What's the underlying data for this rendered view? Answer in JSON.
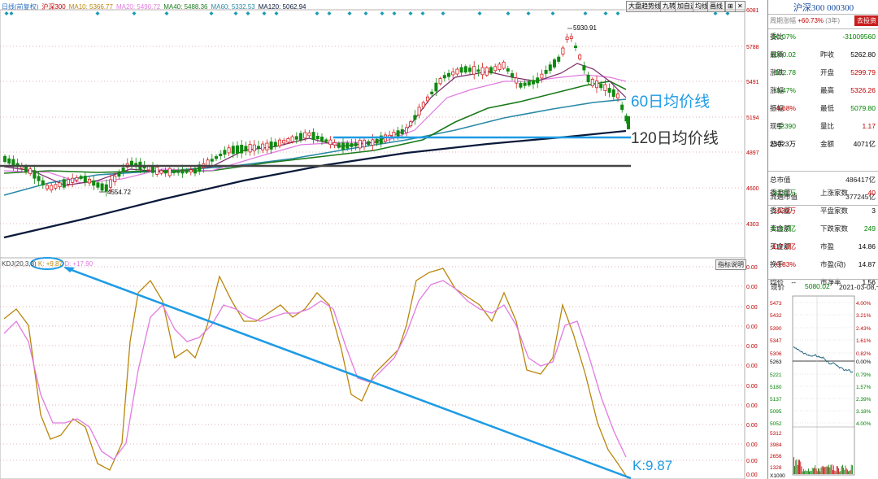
{
  "kline": {
    "period_label": "日线(前复权)",
    "index_name": "沪深300",
    "ma_legend": [
      {
        "label": "MA10: 5366.77",
        "color": "#b8860b"
      },
      {
        "label": "MA20: 5490.72",
        "color": "#e07be0"
      },
      {
        "label": "MA40: 5488.36",
        "color": "#1a7a1a"
      },
      {
        "label": "MA60: 5332.53",
        "color": "#2a8aa6"
      },
      {
        "label": "MA120: 5062.94",
        "color": "#0a1a3a"
      }
    ],
    "price_axis": [
      "6081",
      "5788",
      "5491",
      "5194",
      "4897",
      "4600",
      "4303"
    ],
    "high_label": "5930.91",
    "low_label": "4554.72",
    "annotation_60": "60日均价线",
    "annotation_120": "120日均价线"
  },
  "toolbar": {
    "buttons": [
      "大盘趋势线",
      "九转",
      "加自选",
      "均线",
      "画线"
    ],
    "expand_icon": "expand-icon",
    "close_icon": "close-icon"
  },
  "kdj": {
    "title": "KDJ(20,3,3)",
    "k_value": "K: +9.87",
    "d_value": "D: +17.90",
    "indicator_button": "指标说明",
    "axis_labels": [
      "0.00",
      "0.00",
      "0.00",
      "0.00",
      "0.00",
      "0.00",
      "0.00",
      "0.00",
      "0.00",
      "0.00",
      "0.00",
      "0.00"
    ],
    "annotation_k": "K:9.87"
  },
  "quote": {
    "title": "沪深300 000300",
    "period_stat_label": "周期涨幅",
    "period_stat_value": "+60.73%",
    "period_stat_suffix": "(3年)",
    "trade_button": "去投资",
    "rows": [
      [
        {
          "label": "委比",
          "value": "-60.07%",
          "color": "green"
        },
        {
          "label": "",
          "value": "-31009560",
          "color": "green"
        }
      ],
      [
        {
          "label": "最新",
          "value": "5080.02",
          "color": "green"
        },
        {
          "label": "昨收",
          "value": "5262.80",
          "color": "black"
        }
      ],
      [
        {
          "label": "涨跌",
          "value": "-182.78",
          "color": "green"
        },
        {
          "label": "开盘",
          "value": "5299.79",
          "color": "red"
        }
      ],
      [
        {
          "label": "涨幅",
          "value": "-3.47%",
          "color": "green"
        },
        {
          "label": "最高",
          "value": "5326.26",
          "color": "red"
        }
      ],
      [
        {
          "label": "振幅",
          "value": "4.68%",
          "color": "red"
        },
        {
          "label": "最低",
          "value": "5079.80",
          "color": "green"
        }
      ],
      [
        {
          "label": "现手",
          "value": "52390",
          "color": "green"
        },
        {
          "label": "量比",
          "value": "1.17",
          "color": "red"
        }
      ],
      [
        {
          "label": "总手",
          "value": "23023万",
          "color": "black"
        },
        {
          "label": "金额",
          "value": "4071亿",
          "color": "black"
        }
      ]
    ],
    "market_cap": [
      {
        "label": "总市值",
        "value": "486417亿"
      },
      {
        "label": "流通市值",
        "value": "377245亿"
      }
    ],
    "rows2": [
      [
        {
          "label": "委卖量",
          "value": "4131万",
          "color": "green"
        },
        {
          "label": "上涨家数",
          "value": "40",
          "color": "red"
        }
      ],
      [
        {
          "label": "委买量",
          "value": "1030万",
          "color": "red"
        },
        {
          "label": "平盘家数",
          "value": "3",
          "color": "black"
        }
      ],
      [
        {
          "label": "卖金额",
          "value": "513.7亿",
          "color": "green"
        },
        {
          "label": "下跌家数",
          "value": "249",
          "color": "green"
        }
      ],
      [
        {
          "label": "买金额",
          "value": "117.0亿",
          "color": "red"
        },
        {
          "label": "市盈",
          "value": "14.86",
          "color": "black"
        }
      ],
      [
        {
          "label": "换手",
          "value": "0.83%",
          "color": "red"
        },
        {
          "label": "市盈(动)",
          "value": "14.87",
          "color": "black"
        }
      ],
      [
        {
          "label": "均价",
          "value": "--",
          "color": "black"
        },
        {
          "label": "市净率",
          "value": "1.56",
          "color": "black"
        }
      ]
    ]
  },
  "intraday": {
    "label_now": "现价",
    "now_value": "5080.02",
    "date": "2021-03-08,一",
    "left_axis": [
      "5473",
      "5432",
      "5390",
      "5347",
      "5306",
      "5263",
      "5221",
      "5180",
      "5137",
      "5095",
      "5052"
    ],
    "right_axis": [
      "4.00%",
      "3.21%",
      "2.43%",
      "1.61%",
      "0.82%",
      "0.00%",
      "0.79%",
      "1.57%",
      "2.39%",
      "3.18%",
      "4.00%"
    ],
    "volume_axis": [
      "5312",
      "3984",
      "2656",
      "1328"
    ],
    "volume_unit": "X1000"
  }
}
